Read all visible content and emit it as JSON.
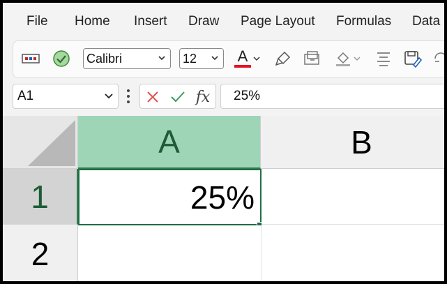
{
  "menu": {
    "items": [
      "File",
      "Home",
      "Insert",
      "Draw",
      "Page Layout",
      "Formulas",
      "Data"
    ]
  },
  "ribbon": {
    "font_name": "Calibri",
    "font_size": "12",
    "font_color_letter": "A",
    "font_color": "#e81123",
    "accent": "#1f6e43"
  },
  "formula_bar": {
    "name_box": "A1",
    "fx_label": "fx",
    "formula_value": "25%"
  },
  "sheet": {
    "columns": [
      "A",
      "B"
    ],
    "rows": [
      "1",
      "2"
    ],
    "cells": {
      "A1": "25%",
      "B1": "",
      "A2": "",
      "B2": ""
    },
    "selected_cell": "A1"
  }
}
